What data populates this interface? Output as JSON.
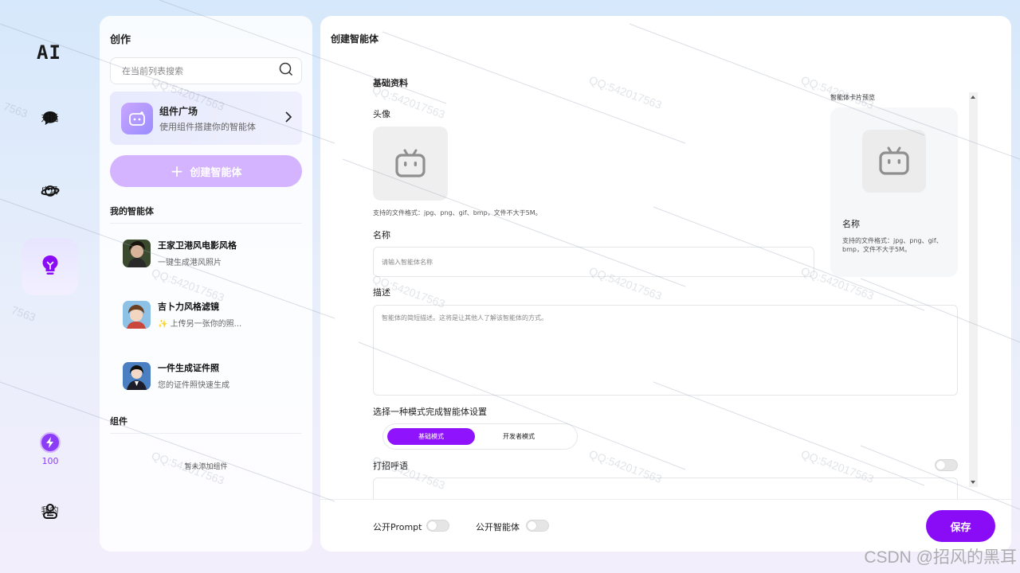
{
  "app": {
    "logo": "AI"
  },
  "nav": {
    "items": [
      {
        "label": "对话",
        "icon": "chat-bubble-icon"
      },
      {
        "label": "广场",
        "icon": "planet-icon"
      },
      {
        "label": "",
        "icon": "lightbulb-icon"
      }
    ],
    "credits": {
      "value": "100",
      "icon": "lightning-icon"
    },
    "profile": {
      "label": "我的",
      "icon": "user-icon"
    }
  },
  "create_panel": {
    "title": "创作",
    "search_placeholder": "在当前列表搜索",
    "plugin_card": {
      "title": "组件广场",
      "subtitle": "使用组件搭建你的智能体"
    },
    "create_button": "创建智能体",
    "my_agents_title": "我的智能体",
    "agents": [
      {
        "name": "王家卫港风电影风格",
        "desc": "一键生成港风照片"
      },
      {
        "name": "吉卜力风格滤镜",
        "desc": "✨ 上传另一张你的照..."
      },
      {
        "name": "一件生成证件照",
        "desc": "您的证件照快速生成"
      }
    ],
    "plugins_title": "组件",
    "plugins_empty": "暂未添加组件"
  },
  "main": {
    "title": "创建智能体",
    "basic_info": "基础资料",
    "avatar_label": "头像",
    "avatar_hint": "支持的文件格式：jpg、png、gif、bmp，文件不大于5M。",
    "name_label": "名称",
    "name_placeholder": "请输入智能体名称",
    "desc_label": "描述",
    "desc_placeholder": "智能体的简短描述。这将是让其他人了解该智能体的方式。",
    "mode_label": "选择一种模式完成智能体设置",
    "modes": [
      "基础模式",
      "开发者模式"
    ],
    "greeting_label": "打招呼语",
    "preview": {
      "title": "智能体卡片预览",
      "name": "名称",
      "hint": "支持的文件格式：jpg、png、gif、bmp，文件不大于5M。"
    }
  },
  "footer": {
    "public_prompt": "公开Prompt",
    "public_agent": "公开智能体",
    "save": "保存"
  },
  "watermark": {
    "text": "QQ:542017563",
    "fragment": "7563",
    "csdn": "CSDN @招风的黑耳"
  },
  "colors": {
    "accent": "#8a0cf7",
    "create_button": "#d5b4ff"
  }
}
